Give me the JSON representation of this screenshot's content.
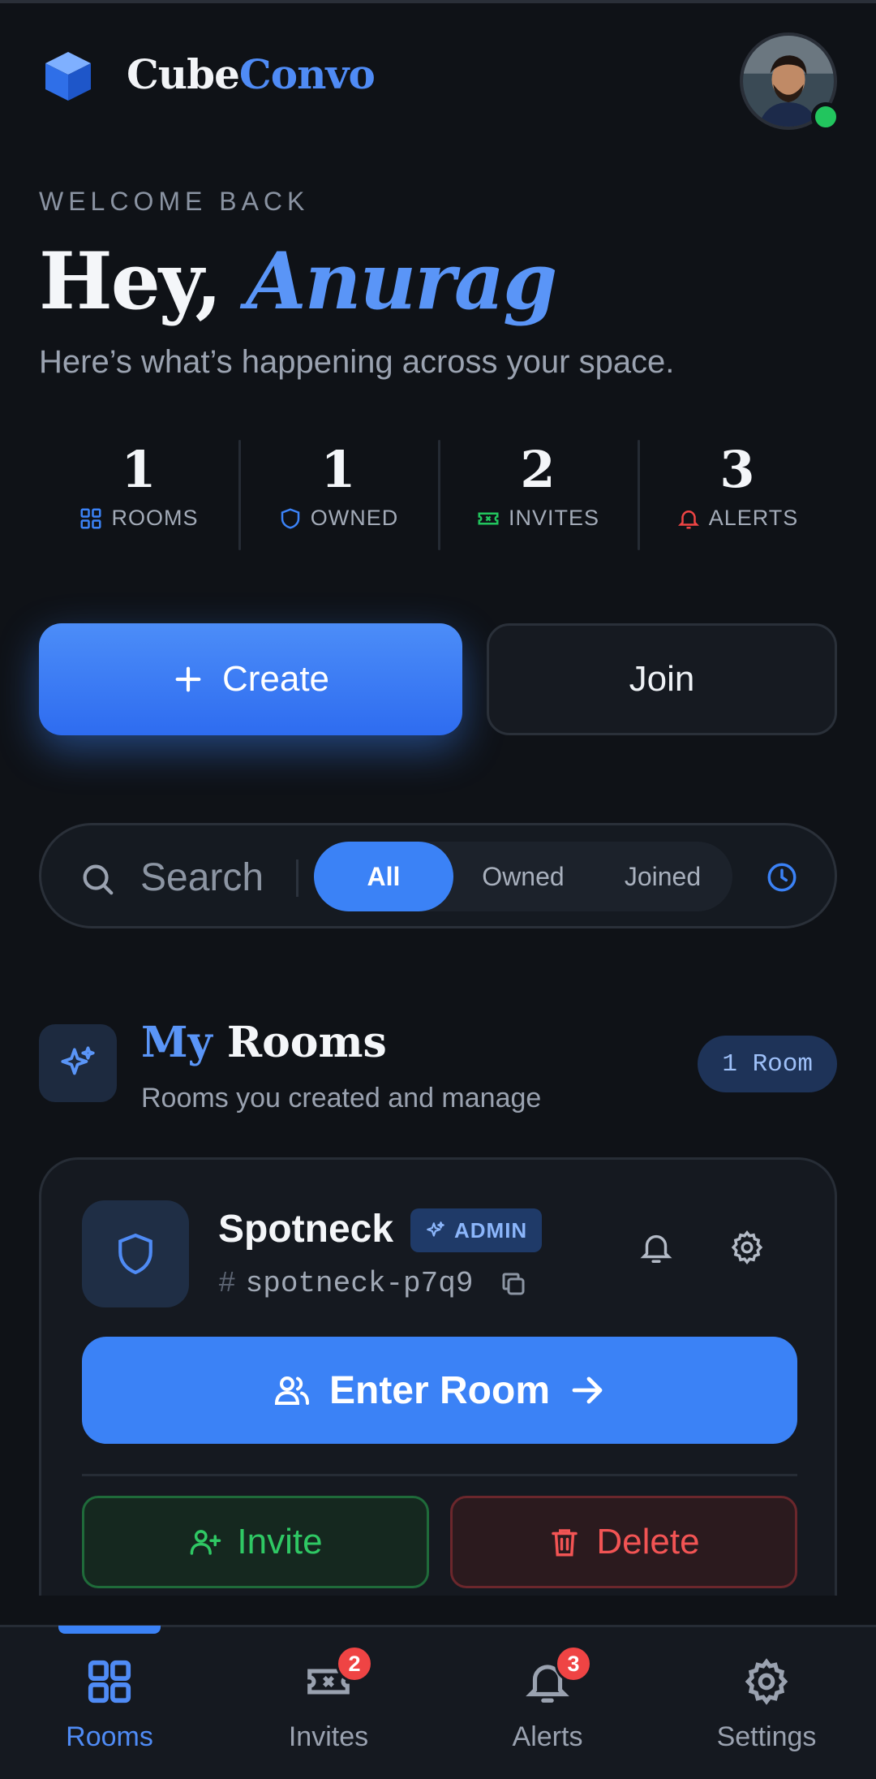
{
  "app": {
    "brand_part1": "Cube",
    "brand_part2": "Convo"
  },
  "welcome": {
    "eyebrow": "WELCOME BACK",
    "greeting": "Hey,",
    "name": "Anurag",
    "subtitle": "Here’s what’s happening across your space."
  },
  "stats": [
    {
      "value": "1",
      "label": "ROOMS",
      "icon": "grid-icon",
      "color": "#3b82f6"
    },
    {
      "value": "1",
      "label": "OWNED",
      "icon": "shield-icon",
      "color": "#3b82f6"
    },
    {
      "value": "2",
      "label": "INVITES",
      "icon": "ticket-icon",
      "color": "#22c55e"
    },
    {
      "value": "3",
      "label": "ALERTS",
      "icon": "bell-icon",
      "color": "#ef4444"
    }
  ],
  "actions": {
    "create_label": "Create",
    "join_label": "Join"
  },
  "search": {
    "placeholder": "Search",
    "value": "",
    "filters": [
      "All",
      "Owned",
      "Joined"
    ],
    "active_filter": "All"
  },
  "section": {
    "title_accent": "My",
    "title_rest": "Rooms",
    "subtitle": "Rooms you created and manage",
    "count_badge": "1 Room"
  },
  "room": {
    "name": "Spotneck",
    "role_badge": "ADMIN",
    "hash": "#",
    "slug": "spotneck-p7q9",
    "enter_label": "Enter Room",
    "invite_label": "Invite",
    "delete_label": "Delete"
  },
  "nav": {
    "items": [
      {
        "label": "Rooms",
        "icon": "grid-icon",
        "badge": ""
      },
      {
        "label": "Invites",
        "icon": "ticket-icon",
        "badge": "2"
      },
      {
        "label": "Alerts",
        "icon": "bell-icon",
        "badge": "3"
      },
      {
        "label": "Settings",
        "icon": "gear-icon",
        "badge": ""
      }
    ],
    "active": "Rooms"
  },
  "colors": {
    "accent": "#3b82f6",
    "success": "#22c55e",
    "danger": "#ef4444",
    "background": "#0f1217"
  }
}
